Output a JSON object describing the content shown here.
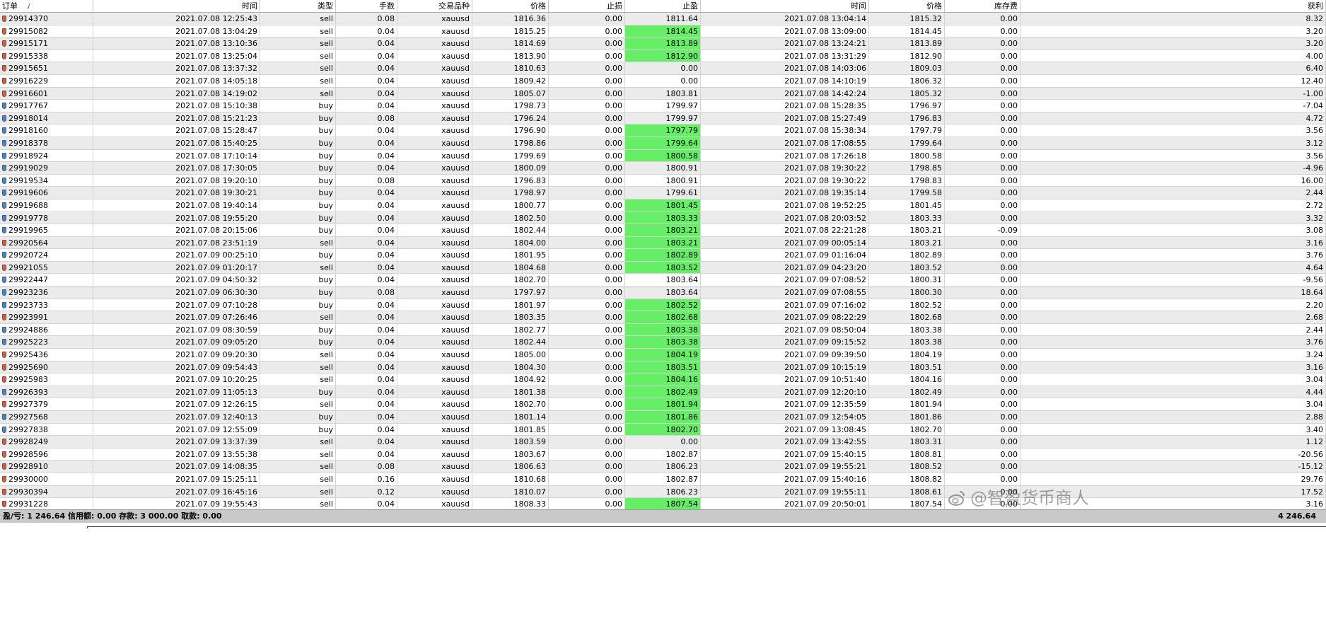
{
  "columns": [
    {
      "label": "订单",
      "sort_mark": "/"
    },
    {
      "label": "时间"
    },
    {
      "label": "类型"
    },
    {
      "label": "手数"
    },
    {
      "label": "交易品种"
    },
    {
      "label": "价格"
    },
    {
      "label": "止损"
    },
    {
      "label": "止盈"
    },
    {
      "label": "时间"
    },
    {
      "label": "价格"
    },
    {
      "label": "库存费"
    },
    {
      "label": "获利"
    }
  ],
  "rows": [
    {
      "order": "29914370",
      "open_time": "2021.07.08 12:25:43",
      "type": "sell",
      "lots": "0.08",
      "symbol": "xauusd",
      "open_price": "1816.36",
      "sl": "0.00",
      "tp": "1811.64",
      "tp_hit": false,
      "close_time": "2021.07.08 13:04:14",
      "close_price": "1815.32",
      "swap": "0.00",
      "profit": "8.32"
    },
    {
      "order": "29915082",
      "open_time": "2021.07.08 13:04:29",
      "type": "sell",
      "lots": "0.04",
      "symbol": "xauusd",
      "open_price": "1815.25",
      "sl": "0.00",
      "tp": "1814.45",
      "tp_hit": true,
      "close_time": "2021.07.08 13:09:00",
      "close_price": "1814.45",
      "swap": "0.00",
      "profit": "3.20"
    },
    {
      "order": "29915171",
      "open_time": "2021.07.08 13:10:36",
      "type": "sell",
      "lots": "0.04",
      "symbol": "xauusd",
      "open_price": "1814.69",
      "sl": "0.00",
      "tp": "1813.89",
      "tp_hit": true,
      "close_time": "2021.07.08 13:24:21",
      "close_price": "1813.89",
      "swap": "0.00",
      "profit": "3.20"
    },
    {
      "order": "29915338",
      "open_time": "2021.07.08 13:25:04",
      "type": "sell",
      "lots": "0.04",
      "symbol": "xauusd",
      "open_price": "1813.90",
      "sl": "0.00",
      "tp": "1812.90",
      "tp_hit": true,
      "close_time": "2021.07.08 13:31:29",
      "close_price": "1812.90",
      "swap": "0.00",
      "profit": "4.00"
    },
    {
      "order": "29915651",
      "open_time": "2021.07.08 13:37:32",
      "type": "sell",
      "lots": "0.04",
      "symbol": "xauusd",
      "open_price": "1810.63",
      "sl": "0.00",
      "tp": "0.00",
      "tp_hit": false,
      "close_time": "2021.07.08 14:03:06",
      "close_price": "1809.03",
      "swap": "0.00",
      "profit": "6.40"
    },
    {
      "order": "29916229",
      "open_time": "2021.07.08 14:05:18",
      "type": "sell",
      "lots": "0.04",
      "symbol": "xauusd",
      "open_price": "1809.42",
      "sl": "0.00",
      "tp": "0.00",
      "tp_hit": false,
      "close_time": "2021.07.08 14:10:19",
      "close_price": "1806.32",
      "swap": "0.00",
      "profit": "12.40"
    },
    {
      "order": "29916601",
      "open_time": "2021.07.08 14:19:02",
      "type": "sell",
      "lots": "0.04",
      "symbol": "xauusd",
      "open_price": "1805.07",
      "sl": "0.00",
      "tp": "1803.81",
      "tp_hit": false,
      "close_time": "2021.07.08 14:42:24",
      "close_price": "1805.32",
      "swap": "0.00",
      "profit": "-1.00"
    },
    {
      "order": "29917767",
      "open_time": "2021.07.08 15:10:38",
      "type": "buy",
      "lots": "0.04",
      "symbol": "xauusd",
      "open_price": "1798.73",
      "sl": "0.00",
      "tp": "1799.97",
      "tp_hit": false,
      "close_time": "2021.07.08 15:28:35",
      "close_price": "1796.97",
      "swap": "0.00",
      "profit": "-7.04"
    },
    {
      "order": "29918014",
      "open_time": "2021.07.08 15:21:23",
      "type": "buy",
      "lots": "0.08",
      "symbol": "xauusd",
      "open_price": "1796.24",
      "sl": "0.00",
      "tp": "1799.97",
      "tp_hit": false,
      "close_time": "2021.07.08 15:27:49",
      "close_price": "1796.83",
      "swap": "0.00",
      "profit": "4.72"
    },
    {
      "order": "29918160",
      "open_time": "2021.07.08 15:28:47",
      "type": "buy",
      "lots": "0.04",
      "symbol": "xauusd",
      "open_price": "1796.90",
      "sl": "0.00",
      "tp": "1797.79",
      "tp_hit": true,
      "close_time": "2021.07.08 15:38:34",
      "close_price": "1797.79",
      "swap": "0.00",
      "profit": "3.56"
    },
    {
      "order": "29918378",
      "open_time": "2021.07.08 15:40:25",
      "type": "buy",
      "lots": "0.04",
      "symbol": "xauusd",
      "open_price": "1798.86",
      "sl": "0.00",
      "tp": "1799.64",
      "tp_hit": true,
      "close_time": "2021.07.08 17:08:55",
      "close_price": "1799.64",
      "swap": "0.00",
      "profit": "3.12"
    },
    {
      "order": "29918924",
      "open_time": "2021.07.08 17:10:14",
      "type": "buy",
      "lots": "0.04",
      "symbol": "xauusd",
      "open_price": "1799.69",
      "sl": "0.00",
      "tp": "1800.58",
      "tp_hit": true,
      "close_time": "2021.07.08 17:26:18",
      "close_price": "1800.58",
      "swap": "0.00",
      "profit": "3.56"
    },
    {
      "order": "29919029",
      "open_time": "2021.07.08 17:30:05",
      "type": "buy",
      "lots": "0.04",
      "symbol": "xauusd",
      "open_price": "1800.09",
      "sl": "0.00",
      "tp": "1800.91",
      "tp_hit": false,
      "close_time": "2021.07.08 19:30:22",
      "close_price": "1798.85",
      "swap": "0.00",
      "profit": "-4.96"
    },
    {
      "order": "29919534",
      "open_time": "2021.07.08 19:20:10",
      "type": "buy",
      "lots": "0.08",
      "symbol": "xauusd",
      "open_price": "1796.83",
      "sl": "0.00",
      "tp": "1800.91",
      "tp_hit": false,
      "close_time": "2021.07.08 19:30:22",
      "close_price": "1798.83",
      "swap": "0.00",
      "profit": "16.00"
    },
    {
      "order": "29919606",
      "open_time": "2021.07.08 19:30:21",
      "type": "buy",
      "lots": "0.04",
      "symbol": "xauusd",
      "open_price": "1798.97",
      "sl": "0.00",
      "tp": "1799.61",
      "tp_hit": false,
      "close_time": "2021.07.08 19:35:14",
      "close_price": "1799.58",
      "swap": "0.00",
      "profit": "2.44"
    },
    {
      "order": "29919688",
      "open_time": "2021.07.08 19:40:14",
      "type": "buy",
      "lots": "0.04",
      "symbol": "xauusd",
      "open_price": "1800.77",
      "sl": "0.00",
      "tp": "1801.45",
      "tp_hit": true,
      "close_time": "2021.07.08 19:52:25",
      "close_price": "1801.45",
      "swap": "0.00",
      "profit": "2.72"
    },
    {
      "order": "29919778",
      "open_time": "2021.07.08 19:55:20",
      "type": "buy",
      "lots": "0.04",
      "symbol": "xauusd",
      "open_price": "1802.50",
      "sl": "0.00",
      "tp": "1803.33",
      "tp_hit": true,
      "close_time": "2021.07.08 20:03:52",
      "close_price": "1803.33",
      "swap": "0.00",
      "profit": "3.32"
    },
    {
      "order": "29919965",
      "open_time": "2021.07.08 20:15:06",
      "type": "buy",
      "lots": "0.04",
      "symbol": "xauusd",
      "open_price": "1802.44",
      "sl": "0.00",
      "tp": "1803.21",
      "tp_hit": true,
      "close_time": "2021.07.08 22:21:28",
      "close_price": "1803.21",
      "swap": "-0.09",
      "profit": "3.08"
    },
    {
      "order": "29920564",
      "open_time": "2021.07.08 23:51:19",
      "type": "sell",
      "lots": "0.04",
      "symbol": "xauusd",
      "open_price": "1804.00",
      "sl": "0.00",
      "tp": "1803.21",
      "tp_hit": true,
      "close_time": "2021.07.09 00:05:14",
      "close_price": "1803.21",
      "swap": "0.00",
      "profit": "3.16"
    },
    {
      "order": "29920724",
      "open_time": "2021.07.09 00:25:10",
      "type": "buy",
      "lots": "0.04",
      "symbol": "xauusd",
      "open_price": "1801.95",
      "sl": "0.00",
      "tp": "1802.89",
      "tp_hit": true,
      "close_time": "2021.07.09 01:16:04",
      "close_price": "1802.89",
      "swap": "0.00",
      "profit": "3.76"
    },
    {
      "order": "29921055",
      "open_time": "2021.07.09 01:20:17",
      "type": "sell",
      "lots": "0.04",
      "symbol": "xauusd",
      "open_price": "1804.68",
      "sl": "0.00",
      "tp": "1803.52",
      "tp_hit": true,
      "close_time": "2021.07.09 04:23:20",
      "close_price": "1803.52",
      "swap": "0.00",
      "profit": "4.64"
    },
    {
      "order": "29922447",
      "open_time": "2021.07.09 04:50:32",
      "type": "buy",
      "lots": "0.04",
      "symbol": "xauusd",
      "open_price": "1802.70",
      "sl": "0.00",
      "tp": "1803.64",
      "tp_hit": false,
      "close_time": "2021.07.09 07:08:52",
      "close_price": "1800.31",
      "swap": "0.00",
      "profit": "-9.56"
    },
    {
      "order": "29923236",
      "open_time": "2021.07.09 06:30:30",
      "type": "buy",
      "lots": "0.08",
      "symbol": "xauusd",
      "open_price": "1797.97",
      "sl": "0.00",
      "tp": "1803.64",
      "tp_hit": false,
      "close_time": "2021.07.09 07:08:55",
      "close_price": "1800.30",
      "swap": "0.00",
      "profit": "18.64"
    },
    {
      "order": "29923733",
      "open_time": "2021.07.09 07:10:28",
      "type": "buy",
      "lots": "0.04",
      "symbol": "xauusd",
      "open_price": "1801.97",
      "sl": "0.00",
      "tp": "1802.52",
      "tp_hit": true,
      "close_time": "2021.07.09 07:16:02",
      "close_price": "1802.52",
      "swap": "0.00",
      "profit": "2.20"
    },
    {
      "order": "29923991",
      "open_time": "2021.07.09 07:26:46",
      "type": "sell",
      "lots": "0.04",
      "symbol": "xauusd",
      "open_price": "1803.35",
      "sl": "0.00",
      "tp": "1802.68",
      "tp_hit": true,
      "close_time": "2021.07.09 08:22:29",
      "close_price": "1802.68",
      "swap": "0.00",
      "profit": "2.68"
    },
    {
      "order": "29924886",
      "open_time": "2021.07.09 08:30:59",
      "type": "buy",
      "lots": "0.04",
      "symbol": "xauusd",
      "open_price": "1802.77",
      "sl": "0.00",
      "tp": "1803.38",
      "tp_hit": true,
      "close_time": "2021.07.09 08:50:04",
      "close_price": "1803.38",
      "swap": "0.00",
      "profit": "2.44"
    },
    {
      "order": "29925223",
      "open_time": "2021.07.09 09:05:20",
      "type": "buy",
      "lots": "0.04",
      "symbol": "xauusd",
      "open_price": "1802.44",
      "sl": "0.00",
      "tp": "1803.38",
      "tp_hit": true,
      "close_time": "2021.07.09 09:15:52",
      "close_price": "1803.38",
      "swap": "0.00",
      "profit": "3.76"
    },
    {
      "order": "29925436",
      "open_time": "2021.07.09 09:20:30",
      "type": "sell",
      "lots": "0.04",
      "symbol": "xauusd",
      "open_price": "1805.00",
      "sl": "0.00",
      "tp": "1804.19",
      "tp_hit": true,
      "close_time": "2021.07.09 09:39:50",
      "close_price": "1804.19",
      "swap": "0.00",
      "profit": "3.24"
    },
    {
      "order": "29925690",
      "open_time": "2021.07.09 09:54:43",
      "type": "sell",
      "lots": "0.04",
      "symbol": "xauusd",
      "open_price": "1804.30",
      "sl": "0.00",
      "tp": "1803.51",
      "tp_hit": true,
      "close_time": "2021.07.09 10:15:19",
      "close_price": "1803.51",
      "swap": "0.00",
      "profit": "3.16"
    },
    {
      "order": "29925983",
      "open_time": "2021.07.09 10:20:25",
      "type": "sell",
      "lots": "0.04",
      "symbol": "xauusd",
      "open_price": "1804.92",
      "sl": "0.00",
      "tp": "1804.16",
      "tp_hit": true,
      "close_time": "2021.07.09 10:51:40",
      "close_price": "1804.16",
      "swap": "0.00",
      "profit": "3.04"
    },
    {
      "order": "29926393",
      "open_time": "2021.07.09 11:05:13",
      "type": "buy",
      "lots": "0.04",
      "symbol": "xauusd",
      "open_price": "1801.38",
      "sl": "0.00",
      "tp": "1802.49",
      "tp_hit": true,
      "close_time": "2021.07.09 12:20:10",
      "close_price": "1802.49",
      "swap": "0.00",
      "profit": "4.44"
    },
    {
      "order": "29927379",
      "open_time": "2021.07.09 12:26:15",
      "type": "sell",
      "lots": "0.04",
      "symbol": "xauusd",
      "open_price": "1802.70",
      "sl": "0.00",
      "tp": "1801.94",
      "tp_hit": true,
      "close_time": "2021.07.09 12:35:59",
      "close_price": "1801.94",
      "swap": "0.00",
      "profit": "3.04"
    },
    {
      "order": "29927568",
      "open_time": "2021.07.09 12:40:13",
      "type": "buy",
      "lots": "0.04",
      "symbol": "xauusd",
      "open_price": "1801.14",
      "sl": "0.00",
      "tp": "1801.86",
      "tp_hit": true,
      "close_time": "2021.07.09 12:54:05",
      "close_price": "1801.86",
      "swap": "0.00",
      "profit": "2.88"
    },
    {
      "order": "29927838",
      "open_time": "2021.07.09 12:55:09",
      "type": "buy",
      "lots": "0.04",
      "symbol": "xauusd",
      "open_price": "1801.85",
      "sl": "0.00",
      "tp": "1802.70",
      "tp_hit": true,
      "close_time": "2021.07.09 13:08:45",
      "close_price": "1802.70",
      "swap": "0.00",
      "profit": "3.40"
    },
    {
      "order": "29928249",
      "open_time": "2021.07.09 13:37:39",
      "type": "sell",
      "lots": "0.04",
      "symbol": "xauusd",
      "open_price": "1803.59",
      "sl": "0.00",
      "tp": "0.00",
      "tp_hit": false,
      "close_time": "2021.07.09 13:42:55",
      "close_price": "1803.31",
      "swap": "0.00",
      "profit": "1.12"
    },
    {
      "order": "29928596",
      "open_time": "2021.07.09 13:55:38",
      "type": "sell",
      "lots": "0.04",
      "symbol": "xauusd",
      "open_price": "1803.67",
      "sl": "0.00",
      "tp": "1802.87",
      "tp_hit": false,
      "close_time": "2021.07.09 15:40:15",
      "close_price": "1808.81",
      "swap": "0.00",
      "profit": "-20.56"
    },
    {
      "order": "29928910",
      "open_time": "2021.07.09 14:08:35",
      "type": "sell",
      "lots": "0.08",
      "symbol": "xauusd",
      "open_price": "1806.63",
      "sl": "0.00",
      "tp": "1806.23",
      "tp_hit": false,
      "close_time": "2021.07.09 19:55:21",
      "close_price": "1808.52",
      "swap": "0.00",
      "profit": "-15.12"
    },
    {
      "order": "29930000",
      "open_time": "2021.07.09 15:25:11",
      "type": "sell",
      "lots": "0.16",
      "symbol": "xauusd",
      "open_price": "1810.68",
      "sl": "0.00",
      "tp": "1802.87",
      "tp_hit": false,
      "close_time": "2021.07.09 15:40:16",
      "close_price": "1808.82",
      "swap": "0.00",
      "profit": "29.76"
    },
    {
      "order": "29930394",
      "open_time": "2021.07.09 16:45:16",
      "type": "sell",
      "lots": "0.12",
      "symbol": "xauusd",
      "open_price": "1810.07",
      "sl": "0.00",
      "tp": "1806.23",
      "tp_hit": false,
      "close_time": "2021.07.09 19:55:11",
      "close_price": "1808.61",
      "swap": "0.00",
      "profit": "17.52"
    },
    {
      "order": "29931228",
      "open_time": "2021.07.09 19:55:43",
      "type": "sell",
      "lots": "0.04",
      "symbol": "xauusd",
      "open_price": "1808.33",
      "sl": "0.00",
      "tp": "1807.54",
      "tp_hit": true,
      "close_time": "2021.07.09 20:50:01",
      "close_price": "1807.54",
      "swap": "0.00",
      "profit": "3.16"
    }
  ],
  "summary": {
    "text": "盈/亏: 1 246.64  信用额: 0.00  存款: 3 000.00  取款: 0.00",
    "total": "4 246.64"
  },
  "watermark": {
    "text": "@智盈货币商人",
    "icon": "weibo-logo-icon"
  },
  "colors": {
    "tp_hit_highlight": "#66ee66",
    "sell_icon": "#e05a3a",
    "buy_icon": "#3a8ad8",
    "summary_bar": "#c9c9c9"
  }
}
